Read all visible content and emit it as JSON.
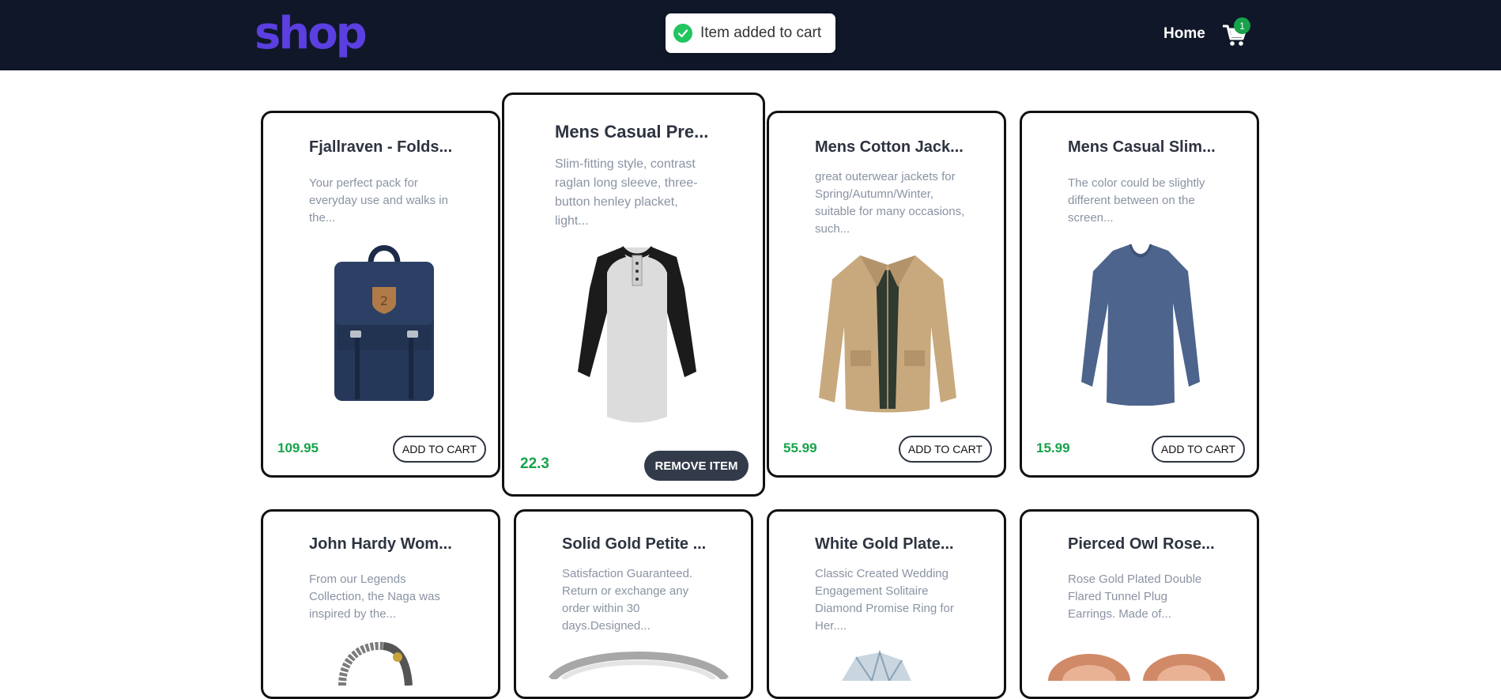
{
  "navbar": {
    "logo": "shop",
    "toast_text": "Item added to cart",
    "home_label": "Home",
    "cart_count": "1"
  },
  "products": [
    {
      "title": "Fjallraven - Folds...",
      "description": "Your perfect pack for everyday use and walks in the...",
      "price": "109.95",
      "button": "ADD TO CART"
    },
    {
      "title": "Mens Casual Pre...",
      "description": "Slim-fitting style, contrast raglan long sleeve, three-button henley placket, light...",
      "price": "22.3",
      "button": "REMOVE ITEM"
    },
    {
      "title": "Mens Cotton Jack...",
      "description": "great outerwear jackets for Spring/Autumn/Winter, suitable for many occasions, such...",
      "price": "55.99",
      "button": "ADD TO CART"
    },
    {
      "title": "Mens Casual Slim...",
      "description": "The color could be slightly different between on the screen...",
      "price": "15.99",
      "button": "ADD TO CART"
    },
    {
      "title": "John Hardy Wom...",
      "description": "From our Legends Collection, the Naga was inspired by the..."
    },
    {
      "title": "Solid Gold Petite ...",
      "description": "Satisfaction Guaranteed. Return or exchange any order within 30 days.Designed..."
    },
    {
      "title": "White Gold Plate...",
      "description": "Classic Created Wedding Engagement Solitaire Diamond Promise Ring for Her...."
    },
    {
      "title": "Pierced Owl Rose...",
      "description": "Rose Gold Plated Double Flared Tunnel Plug Earrings. Made of..."
    }
  ],
  "colors": {
    "navbar": "#101729",
    "logo": "#5b3fe0",
    "price": "#16a34a",
    "badge": "#16a34a"
  }
}
